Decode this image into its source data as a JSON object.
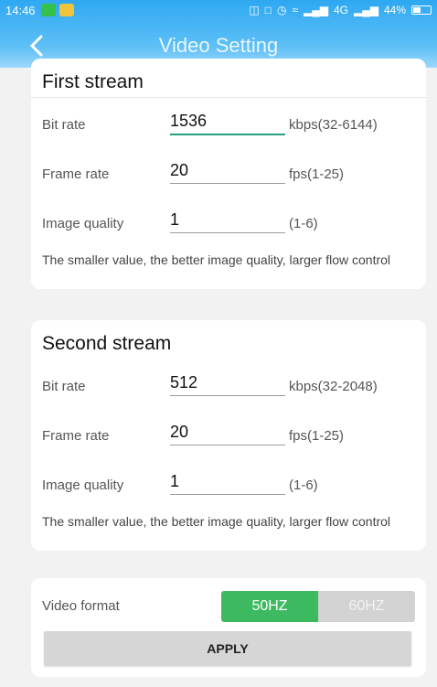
{
  "status_bar": {
    "time": "14:46",
    "network_label": "4G",
    "battery": "44%"
  },
  "header": {
    "title": "Video Setting",
    "back_icon": "chevron-left-icon"
  },
  "first_stream": {
    "title": "First stream",
    "bit_rate": {
      "label": "Bit rate",
      "value": "1536",
      "range": "kbps(32-6144)"
    },
    "frame_rate": {
      "label": "Frame rate",
      "value": "20",
      "range": "fps(1-25)"
    },
    "image_quality": {
      "label": "Image quality",
      "value": "1",
      "range": "(1-6)"
    },
    "note": "The smaller value, the better image quality, larger flow control"
  },
  "second_stream": {
    "title": "Second stream",
    "bit_rate": {
      "label": "Bit rate",
      "value": "512",
      "range": "kbps(32-2048)"
    },
    "frame_rate": {
      "label": "Frame rate",
      "value": "20",
      "range": "fps(1-25)"
    },
    "image_quality": {
      "label": "Image quality",
      "value": "1",
      "range": "(1-6)"
    },
    "note": "The smaller value, the better image quality, larger flow control"
  },
  "video_format": {
    "label": "Video format",
    "options": [
      "50HZ",
      "60HZ"
    ],
    "selected": "50HZ"
  },
  "apply_label": "APPLY",
  "colors": {
    "header_top": "#2ea8f2",
    "accent_green": "#3dba5f",
    "focus_line": "#2a9f86"
  }
}
